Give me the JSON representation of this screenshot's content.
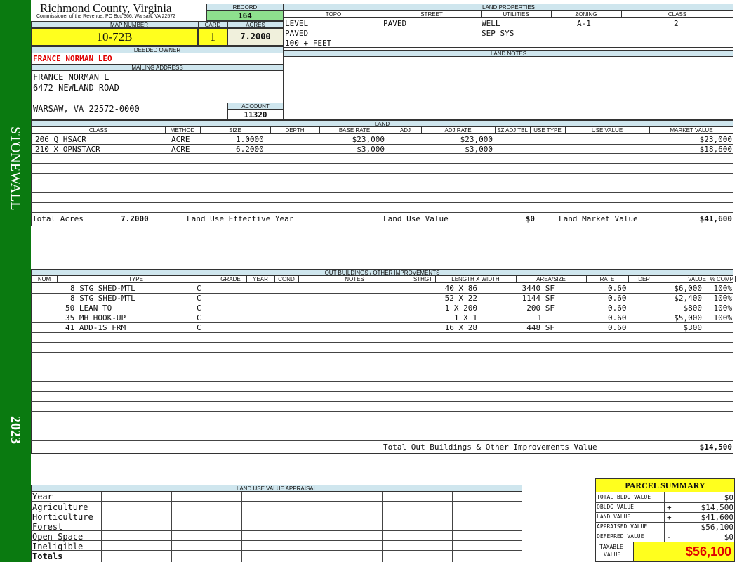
{
  "side": {
    "district": "STONEWALL",
    "year": "2023"
  },
  "header": {
    "county": "Richmond County, Virginia",
    "commissioner": "Commissioner of the Revenue, PO Box 366, Warsaw, VA 22572",
    "record_label": "RECORD",
    "record_value": "164",
    "map_label": "MAP NUMBER",
    "map_value": "10-72B",
    "card_label": "CARD",
    "card_value": "1",
    "acres_label": "ACRES",
    "acres_value": "7.2000"
  },
  "owner": {
    "deeded_label": "DEEDED OWNER",
    "deeded_value": "FRANCE NORMAN LEO",
    "mailing_label": "MAILING ADDRESS",
    "mail_line1": "FRANCE NORMAN L",
    "mail_line2": "6472 NEWLAND ROAD",
    "mail_line3": "WARSAW, VA 22572-0000",
    "account_label": "ACCOUNT",
    "account_value": "11320"
  },
  "land_properties": {
    "title": "LAND PROPERTIES",
    "columns": [
      "TOPO",
      "STREET",
      "UTILITIES",
      "ZONING",
      "CLASS"
    ],
    "topo": [
      "LEVEL",
      "PAVED",
      "100 + FEET"
    ],
    "street": "PAVED",
    "utilities": [
      "WELL",
      "SEP SYS"
    ],
    "zoning": "A-1",
    "class": "2"
  },
  "land_notes": {
    "title": "LAND NOTES"
  },
  "land": {
    "title": "LAND",
    "columns": [
      "CLASS",
      "METHOD",
      "SIZE",
      "DEPTH",
      "BASE RATE",
      "ADJ",
      "ADJ RATE",
      "SZ ADJ TBL",
      "USE TYPE",
      "USE VALUE",
      "MARKET VALUE"
    ],
    "rows": [
      {
        "class": "206 Q HSACR",
        "method": "ACRE",
        "size": "1.0000",
        "base_rate": "$23,000",
        "adj_rate": "$23,000",
        "market": "$23,000"
      },
      {
        "class": "210 X OPNSTACR",
        "method": "ACRE",
        "size": "6.2000",
        "base_rate": "$3,000",
        "adj_rate": "$3,000",
        "market": "$18,600"
      }
    ],
    "total_acres_label": "Total Acres",
    "total_acres_value": "7.2000",
    "effective_year_label": "Land Use Effective Year",
    "use_value_label": "Land Use Value",
    "use_value": "$0",
    "market_value_label": "Land Market Value",
    "market_value": "$41,600"
  },
  "outbuildings": {
    "title": "OUT BUILDINGS / OTHER IMPROVEMENTS",
    "columns": [
      "NUM",
      "TYPE",
      "GRADE",
      "YEAR",
      "COND",
      "NOTES",
      "STHGT",
      "LENGTH X WIDTH",
      "AREA/SIZE",
      "RATE",
      "DEP",
      "VALUE",
      "% COMP"
    ],
    "rows": [
      {
        "type": "8 STG SHED-MTL",
        "grade": "C",
        "lw": "40 X 86",
        "area": "3440 SF",
        "dep": "0.60",
        "value": "$6,000",
        "comp": "100%"
      },
      {
        "type": "8 STG SHED-MTL",
        "grade": "C",
        "lw": "52 X 22",
        "area": "1144 SF",
        "dep": "0.60",
        "value": "$2,400",
        "comp": "100%"
      },
      {
        "type": "50 LEAN TO",
        "grade": "C",
        "lw": "1 X 200",
        "area": "200 SF",
        "dep": "0.60",
        "value": "$800",
        "comp": "100%"
      },
      {
        "type": "35 MH HOOK-UP",
        "grade": "C",
        "lw": "1 X 1",
        "area": "1",
        "dep": "0.60",
        "value": "$5,000",
        "comp": "100%"
      },
      {
        "type": "41 ADD-1S FRM",
        "grade": "C",
        "lw": "16 X 28",
        "area": "448 SF",
        "dep": "0.60",
        "value": "$300",
        "comp": ""
      }
    ],
    "total_label": "Total Out Buildings & Other Improvements Value",
    "total_value": "$14,500"
  },
  "land_use": {
    "title": "LAND USE VALUE APPRAISAL",
    "rows": [
      "Year",
      "Agriculture",
      "Horticulture",
      "Forest",
      "Open Space",
      "Ineligible",
      "Totals"
    ]
  },
  "summary": {
    "title": "PARCEL SUMMARY",
    "rows": [
      {
        "label": "TOTAL BLDG VALUE",
        "sign": "",
        "value": "$0"
      },
      {
        "label": "OBLDG VALUE",
        "sign": "+",
        "value": "$14,500"
      },
      {
        "label": "LAND VALUE",
        "sign": "+",
        "value": "$41,600"
      },
      {
        "label": "APPRAISED VALUE",
        "sign": "",
        "value": "$56,100"
      },
      {
        "label": "DEFERRED VALUE",
        "sign": "-",
        "value": "$0"
      }
    ],
    "taxable_label_1": "TAXABLE",
    "taxable_label_2": "VALUE",
    "taxable_value": "$56,100"
  },
  "colors": {
    "strip": "#0a7a10",
    "header_bg": "#cfe6ee",
    "yellow": "#ffff1e",
    "green_light": "#8ee08e",
    "red": "#e00000"
  }
}
